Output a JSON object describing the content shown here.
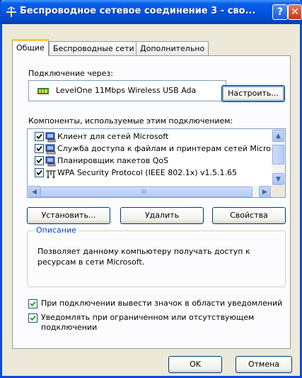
{
  "window": {
    "title": "Беспроводное сетевое соединение 3 - сво...",
    "help_label": "?",
    "close_label": "✕"
  },
  "tabs": [
    {
      "label": "Общие",
      "active": true
    },
    {
      "label": "Беспроводные сети",
      "active": false
    },
    {
      "label": "Дополнительно",
      "active": false
    }
  ],
  "connect": {
    "label": "Подключение через:",
    "adapter": "LevelOne 11Mbps Wireless USB Ada",
    "configure_label": "Настроить..."
  },
  "components": {
    "label": "Компоненты, используемые этим подключением:",
    "items": [
      {
        "label": "Клиент для сетей Microsoft",
        "checked": true,
        "icon": "network-client-icon"
      },
      {
        "label": "Служба доступа к файлам и принтерам сетей Micro",
        "checked": true,
        "icon": "file-printer-sharing-icon"
      },
      {
        "label": "Планировщик пакетов QoS",
        "checked": true,
        "icon": "qos-scheduler-icon"
      },
      {
        "label": "WPA Security Protocol (IEEE 802.1x) v1.5.1.65",
        "checked": true,
        "icon": "protocol-icon"
      }
    ],
    "hscroll_grip": "III"
  },
  "actions": {
    "install_label": "Установить...",
    "remove_label": "Удалить",
    "properties_label": "Свойства"
  },
  "description": {
    "title": "Описание",
    "text": "Позволяет данному компьютеру получать доступ к ресурсам в сети Microsoft."
  },
  "options": [
    {
      "label": "При подключении вывести значок в области уведомлений",
      "checked": true
    },
    {
      "label": "Уведомлять при ограниченном или отсутствующем подключении",
      "checked": true
    }
  ],
  "footer": {
    "ok_label": "OK",
    "cancel_label": "Отмена"
  },
  "colors": {
    "title_bar": "#0054e3",
    "window_face": "#ece9d8",
    "tab_highlight": "#ffc83c",
    "group_title": "#0046d5",
    "checkmark": "#21a121"
  }
}
